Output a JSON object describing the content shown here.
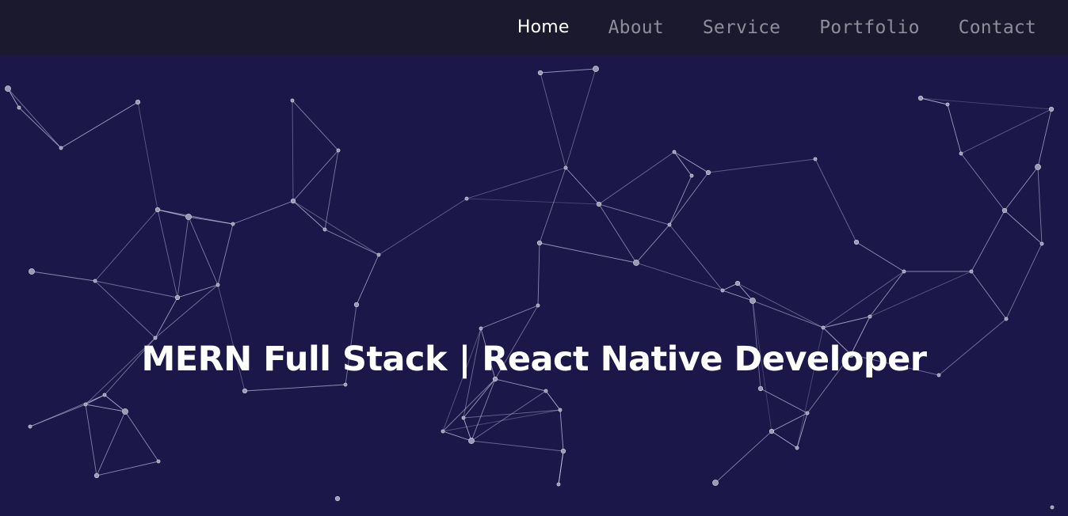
{
  "nav": {
    "items": [
      {
        "label": "Home",
        "active": true
      },
      {
        "label": "About",
        "active": false
      },
      {
        "label": "Service",
        "active": false
      },
      {
        "label": "Portfolio",
        "active": false
      },
      {
        "label": "Contact",
        "active": false
      }
    ]
  },
  "hero": {
    "title": "MERN Full Stack | React Native Developer"
  },
  "colors": {
    "nav_bg": "#1a192e",
    "hero_bg": "#1b1849",
    "nav_text": "#8e8e9a",
    "nav_active": "#ffffff",
    "particle": "#c9c9e6"
  }
}
